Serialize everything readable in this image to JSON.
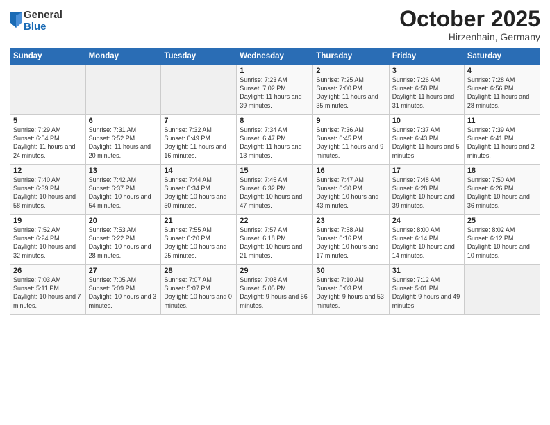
{
  "logo": {
    "general": "General",
    "blue": "Blue"
  },
  "title": "October 2025",
  "subtitle": "Hirzenhain, Germany",
  "headers": [
    "Sunday",
    "Monday",
    "Tuesday",
    "Wednesday",
    "Thursday",
    "Friday",
    "Saturday"
  ],
  "weeks": [
    [
      {
        "day": "",
        "info": ""
      },
      {
        "day": "",
        "info": ""
      },
      {
        "day": "",
        "info": ""
      },
      {
        "day": "1",
        "info": "Sunrise: 7:23 AM\nSunset: 7:02 PM\nDaylight: 11 hours\nand 39 minutes."
      },
      {
        "day": "2",
        "info": "Sunrise: 7:25 AM\nSunset: 7:00 PM\nDaylight: 11 hours\nand 35 minutes."
      },
      {
        "day": "3",
        "info": "Sunrise: 7:26 AM\nSunset: 6:58 PM\nDaylight: 11 hours\nand 31 minutes."
      },
      {
        "day": "4",
        "info": "Sunrise: 7:28 AM\nSunset: 6:56 PM\nDaylight: 11 hours\nand 28 minutes."
      }
    ],
    [
      {
        "day": "5",
        "info": "Sunrise: 7:29 AM\nSunset: 6:54 PM\nDaylight: 11 hours\nand 24 minutes."
      },
      {
        "day": "6",
        "info": "Sunrise: 7:31 AM\nSunset: 6:52 PM\nDaylight: 11 hours\nand 20 minutes."
      },
      {
        "day": "7",
        "info": "Sunrise: 7:32 AM\nSunset: 6:49 PM\nDaylight: 11 hours\nand 16 minutes."
      },
      {
        "day": "8",
        "info": "Sunrise: 7:34 AM\nSunset: 6:47 PM\nDaylight: 11 hours\nand 13 minutes."
      },
      {
        "day": "9",
        "info": "Sunrise: 7:36 AM\nSunset: 6:45 PM\nDaylight: 11 hours\nand 9 minutes."
      },
      {
        "day": "10",
        "info": "Sunrise: 7:37 AM\nSunset: 6:43 PM\nDaylight: 11 hours\nand 5 minutes."
      },
      {
        "day": "11",
        "info": "Sunrise: 7:39 AM\nSunset: 6:41 PM\nDaylight: 11 hours\nand 2 minutes."
      }
    ],
    [
      {
        "day": "12",
        "info": "Sunrise: 7:40 AM\nSunset: 6:39 PM\nDaylight: 10 hours\nand 58 minutes."
      },
      {
        "day": "13",
        "info": "Sunrise: 7:42 AM\nSunset: 6:37 PM\nDaylight: 10 hours\nand 54 minutes."
      },
      {
        "day": "14",
        "info": "Sunrise: 7:44 AM\nSunset: 6:34 PM\nDaylight: 10 hours\nand 50 minutes."
      },
      {
        "day": "15",
        "info": "Sunrise: 7:45 AM\nSunset: 6:32 PM\nDaylight: 10 hours\nand 47 minutes."
      },
      {
        "day": "16",
        "info": "Sunrise: 7:47 AM\nSunset: 6:30 PM\nDaylight: 10 hours\nand 43 minutes."
      },
      {
        "day": "17",
        "info": "Sunrise: 7:48 AM\nSunset: 6:28 PM\nDaylight: 10 hours\nand 39 minutes."
      },
      {
        "day": "18",
        "info": "Sunrise: 7:50 AM\nSunset: 6:26 PM\nDaylight: 10 hours\nand 36 minutes."
      }
    ],
    [
      {
        "day": "19",
        "info": "Sunrise: 7:52 AM\nSunset: 6:24 PM\nDaylight: 10 hours\nand 32 minutes."
      },
      {
        "day": "20",
        "info": "Sunrise: 7:53 AM\nSunset: 6:22 PM\nDaylight: 10 hours\nand 28 minutes."
      },
      {
        "day": "21",
        "info": "Sunrise: 7:55 AM\nSunset: 6:20 PM\nDaylight: 10 hours\nand 25 minutes."
      },
      {
        "day": "22",
        "info": "Sunrise: 7:57 AM\nSunset: 6:18 PM\nDaylight: 10 hours\nand 21 minutes."
      },
      {
        "day": "23",
        "info": "Sunrise: 7:58 AM\nSunset: 6:16 PM\nDaylight: 10 hours\nand 17 minutes."
      },
      {
        "day": "24",
        "info": "Sunrise: 8:00 AM\nSunset: 6:14 PM\nDaylight: 10 hours\nand 14 minutes."
      },
      {
        "day": "25",
        "info": "Sunrise: 8:02 AM\nSunset: 6:12 PM\nDaylight: 10 hours\nand 10 minutes."
      }
    ],
    [
      {
        "day": "26",
        "info": "Sunrise: 7:03 AM\nSunset: 5:11 PM\nDaylight: 10 hours\nand 7 minutes."
      },
      {
        "day": "27",
        "info": "Sunrise: 7:05 AM\nSunset: 5:09 PM\nDaylight: 10 hours\nand 3 minutes."
      },
      {
        "day": "28",
        "info": "Sunrise: 7:07 AM\nSunset: 5:07 PM\nDaylight: 10 hours\nand 0 minutes."
      },
      {
        "day": "29",
        "info": "Sunrise: 7:08 AM\nSunset: 5:05 PM\nDaylight: 9 hours\nand 56 minutes."
      },
      {
        "day": "30",
        "info": "Sunrise: 7:10 AM\nSunset: 5:03 PM\nDaylight: 9 hours\nand 53 minutes."
      },
      {
        "day": "31",
        "info": "Sunrise: 7:12 AM\nSunset: 5:01 PM\nDaylight: 9 hours\nand 49 minutes."
      },
      {
        "day": "",
        "info": ""
      }
    ]
  ]
}
